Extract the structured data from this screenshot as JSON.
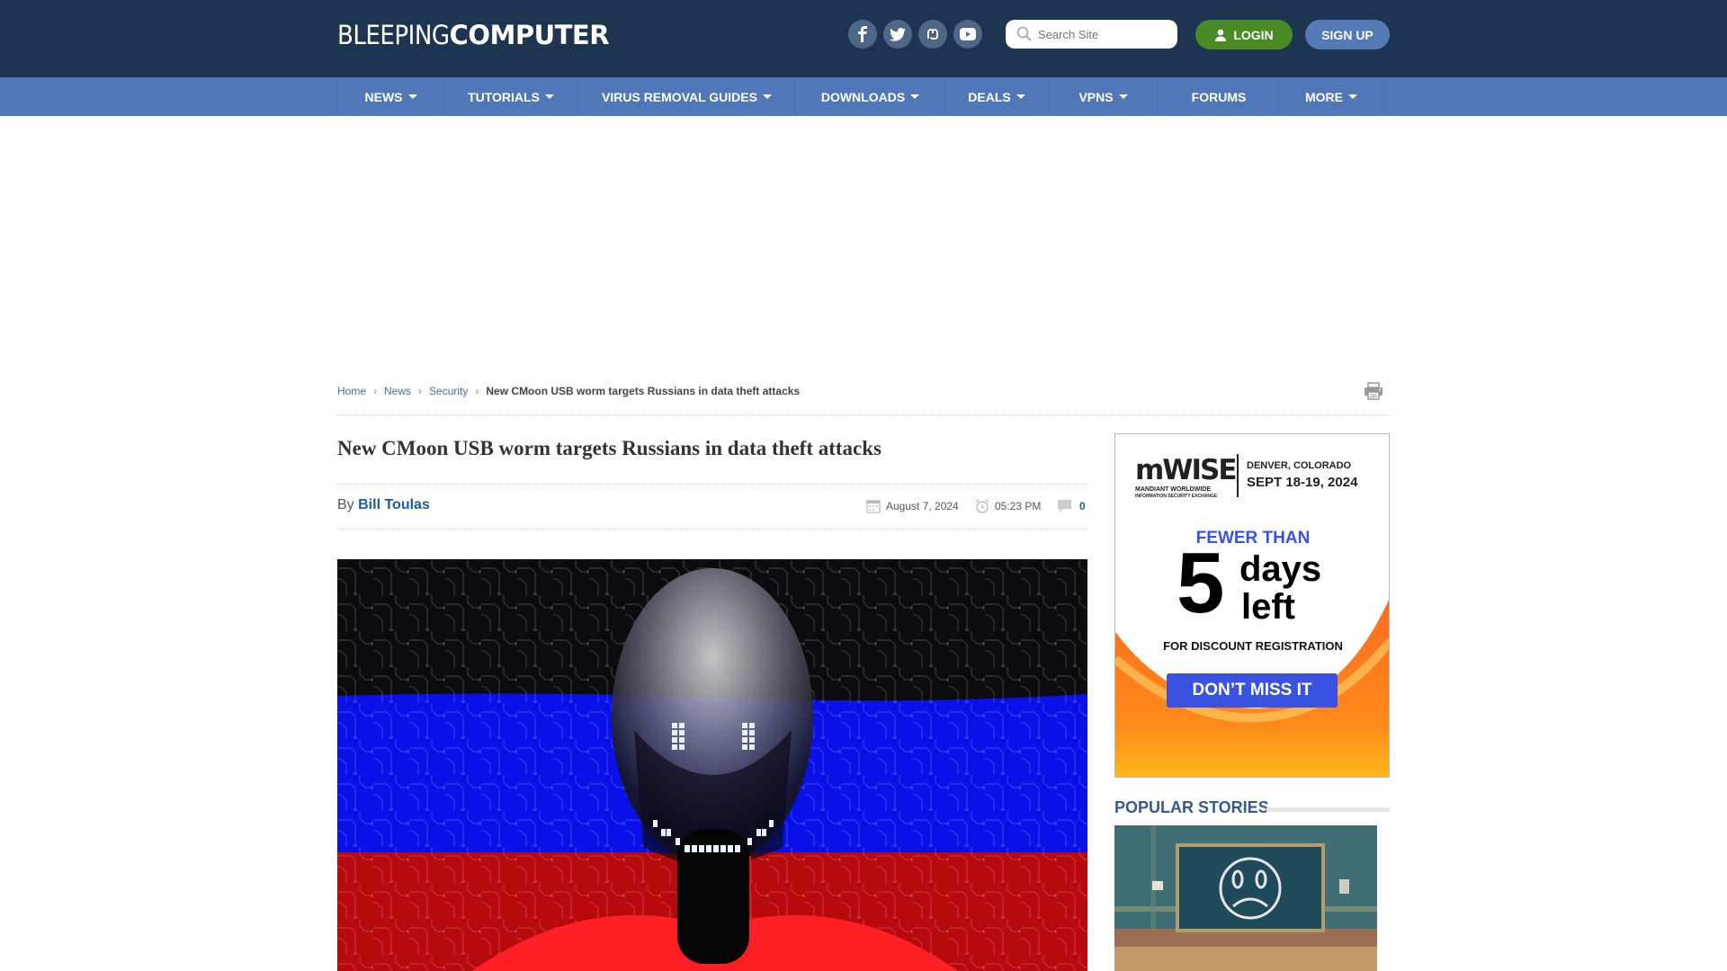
{
  "header": {
    "logo_thin": "BLEEPING",
    "logo_bold": "COMPUTER",
    "social": [
      {
        "name": "facebook",
        "glyph": "f"
      },
      {
        "name": "twitter",
        "glyph": "t"
      },
      {
        "name": "mastodon",
        "glyph": "m"
      },
      {
        "name": "youtube",
        "glyph": "▶"
      }
    ],
    "search_placeholder": "Search Site",
    "login_label": "LOGIN",
    "signup_label": "SIGN UP"
  },
  "nav": {
    "items": [
      {
        "label": "NEWS",
        "dropdown": true
      },
      {
        "label": "TUTORIALS",
        "dropdown": true
      },
      {
        "label": "VIRUS REMOVAL GUIDES",
        "dropdown": true
      },
      {
        "label": "DOWNLOADS",
        "dropdown": true
      },
      {
        "label": "DEALS",
        "dropdown": true
      },
      {
        "label": "VPNS",
        "dropdown": true
      },
      {
        "label": "FORUMS",
        "dropdown": false
      },
      {
        "label": "MORE",
        "dropdown": true
      }
    ]
  },
  "breadcrumb": {
    "items": [
      "Home",
      "News",
      "Security"
    ],
    "current": "New CMoon USB worm targets Russians in data theft attacks"
  },
  "article": {
    "title": "New CMoon USB worm targets Russians in data theft attacks",
    "by_label": "By",
    "author": "Bill Toulas",
    "date": "August 7, 2024",
    "time": "05:23 PM",
    "comments": "0"
  },
  "ad": {
    "brand": "mWISE",
    "brand_sub1": "MANDIANT WORLDWIDE",
    "brand_sub2": "INFORMATION SECURITY EXCHANGE",
    "location": "DENVER, COLORADO",
    "dates": "SEPT 18-19, 2024",
    "fewer_than": "FEWER THAN",
    "number": "5",
    "days": "days",
    "left": "left",
    "discount": "FOR DISCOUNT REGISTRATION",
    "cta": "DON’T MISS IT"
  },
  "sidebar": {
    "popular_heading": "POPULAR STORIES"
  },
  "colors": {
    "topbar": "#1e3552",
    "navbar": "#5078b8",
    "login": "#4a8a25",
    "signup": "#5579b7",
    "link": "#3f6fb5",
    "ad_blue": "#3a52e0"
  }
}
